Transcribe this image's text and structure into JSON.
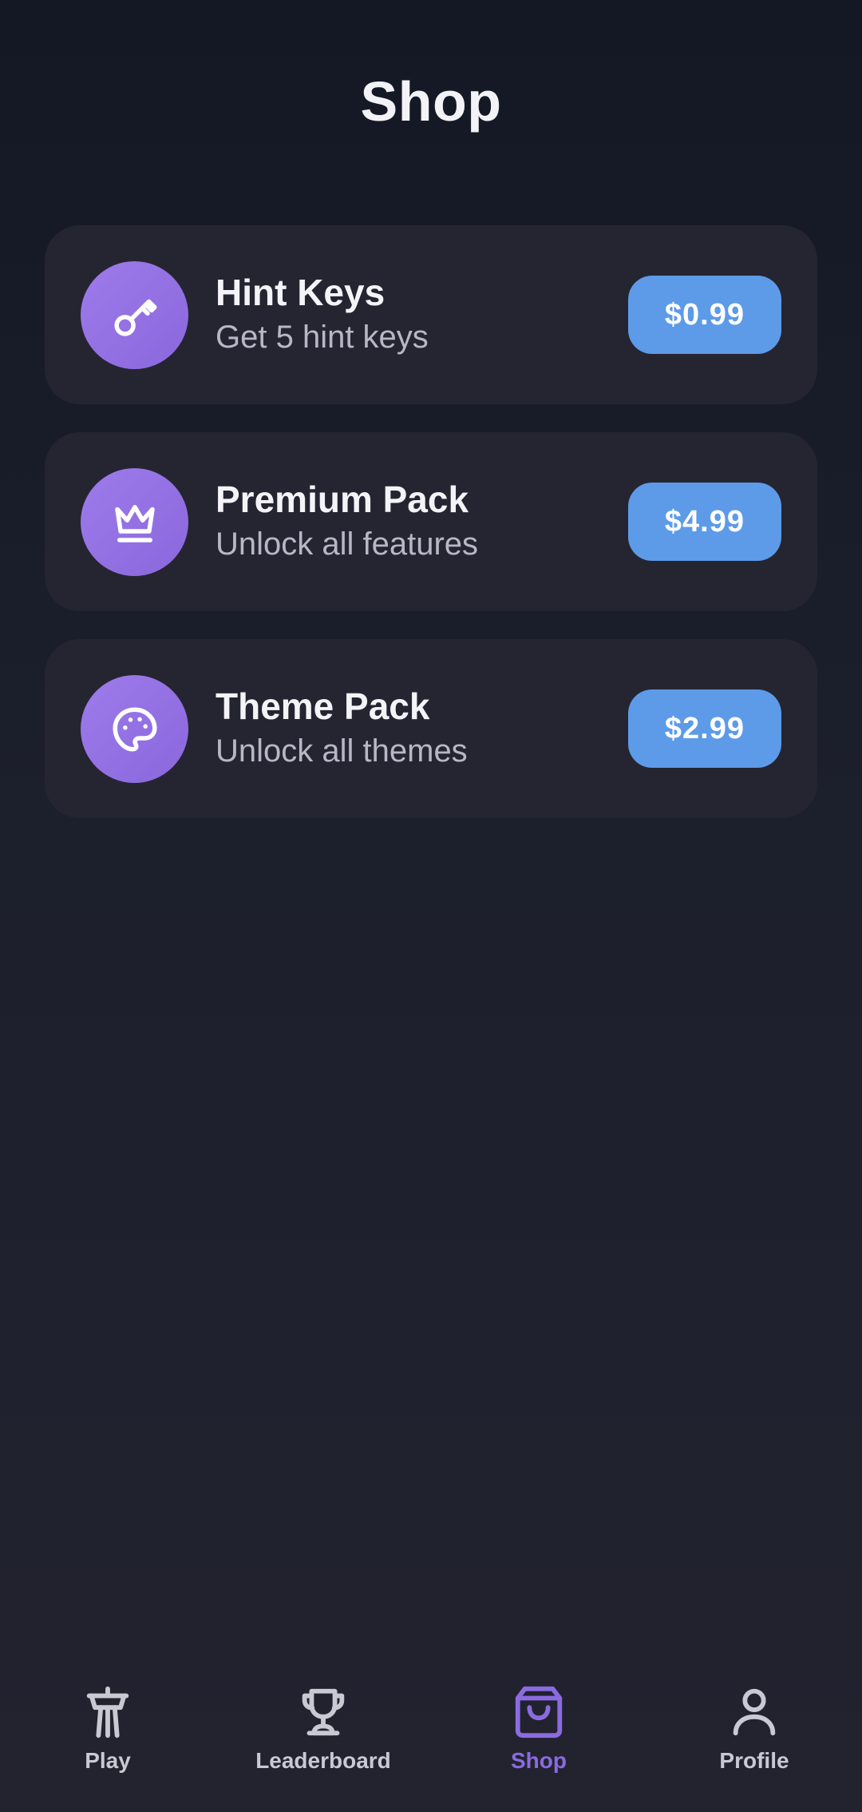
{
  "header": {
    "title": "Shop"
  },
  "items": [
    {
      "title": "Hint Keys",
      "description": "Get 5 hint keys",
      "price": "$0.99",
      "icon": "key-icon"
    },
    {
      "title": "Premium Pack",
      "description": "Unlock all features",
      "price": "$4.99",
      "icon": "crown-icon"
    },
    {
      "title": "Theme Pack",
      "description": "Unlock all themes",
      "price": "$2.99",
      "icon": "palette-icon"
    }
  ],
  "nav": {
    "items": [
      {
        "label": "Play",
        "icon": "tower-icon",
        "active": false
      },
      {
        "label": "Leaderboard",
        "icon": "trophy-icon",
        "active": false
      },
      {
        "label": "Shop",
        "icon": "shopping-bag-icon",
        "active": true
      },
      {
        "label": "Profile",
        "icon": "person-icon",
        "active": false
      }
    ]
  },
  "colors": {
    "background": "#1c1f2c",
    "card": "#252532",
    "icon_circle": "#9475e6",
    "price_button": "#5d9be8",
    "nav_active": "#8a6be0",
    "nav_inactive": "#c8c9d2"
  }
}
